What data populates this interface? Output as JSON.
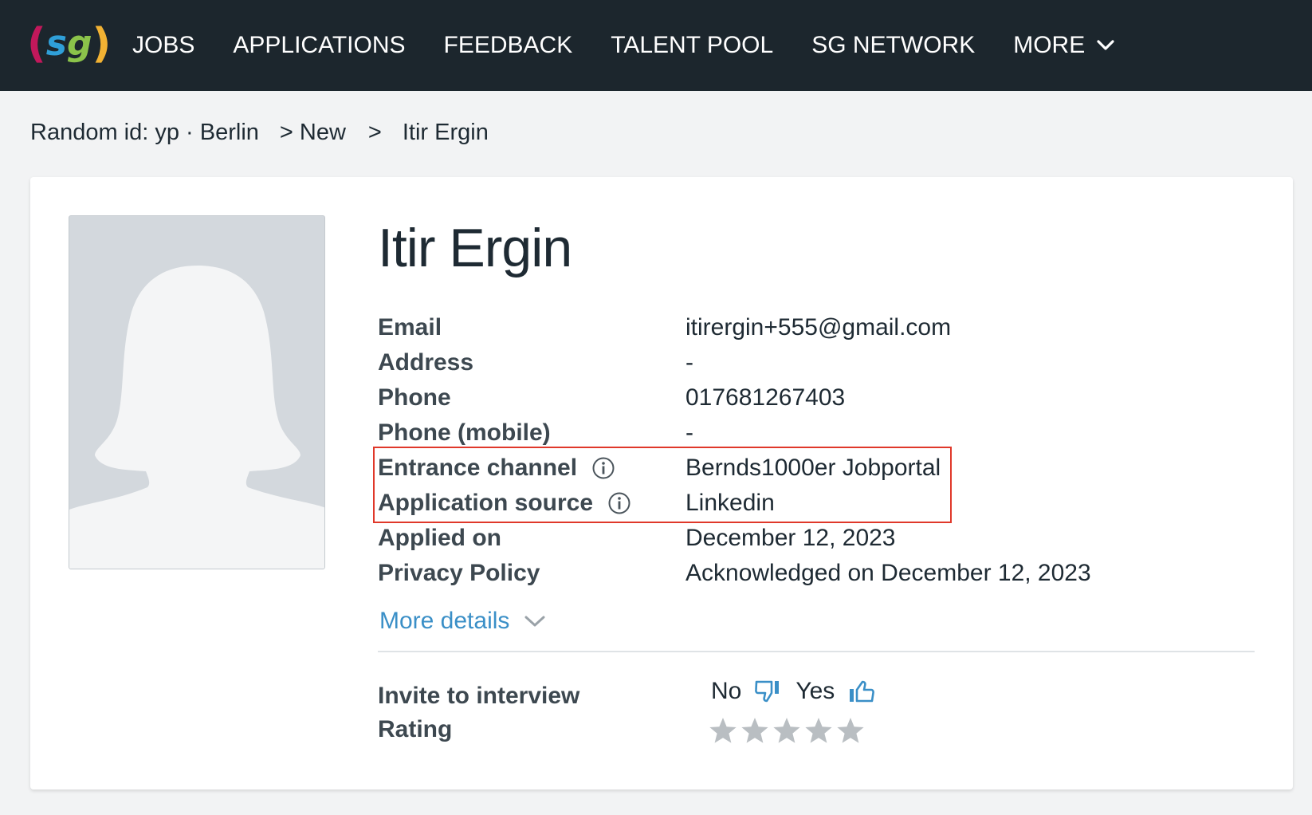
{
  "header": {
    "logo_text": "sg",
    "nav": [
      {
        "label": "JOBS"
      },
      {
        "label": "APPLICATIONS"
      },
      {
        "label": "FEEDBACK"
      },
      {
        "label": "TALENT POOL"
      },
      {
        "label": "SG NETWORK"
      },
      {
        "label": "MORE"
      }
    ]
  },
  "breadcrumb": {
    "job": "Random id: yp · Berlin",
    "stage": "> New",
    "separator": ">",
    "candidate": "Itir Ergin"
  },
  "candidate": {
    "name": "Itir Ergin",
    "fields": [
      {
        "label": "Email",
        "value": "itirergin+555@gmail.com"
      },
      {
        "label": "Address",
        "value": "-"
      },
      {
        "label": "Phone",
        "value": "017681267403"
      },
      {
        "label": "Phone (mobile)",
        "value": "-"
      },
      {
        "label": "Entrance channel",
        "value": "Bernds1000er Jobportal",
        "icon": "info-icon"
      },
      {
        "label": "Application source",
        "value": "Linkedin",
        "icon": "info-icon"
      },
      {
        "label": "Applied on",
        "value": "December 12, 2023"
      },
      {
        "label": "Privacy Policy",
        "value": "Acknowledged on December 12, 2023"
      }
    ],
    "more_details": "More details"
  },
  "evaluation": {
    "invite_label": "Invite to interview",
    "no_label": "No",
    "yes_label": "Yes",
    "rating_label": "Rating",
    "rating": 0,
    "rating_max": 5
  },
  "colors": {
    "topbar": "#1c262d",
    "link": "#3a8fc7",
    "highlight": "#e0382a",
    "star_empty": "#b9bec2"
  }
}
